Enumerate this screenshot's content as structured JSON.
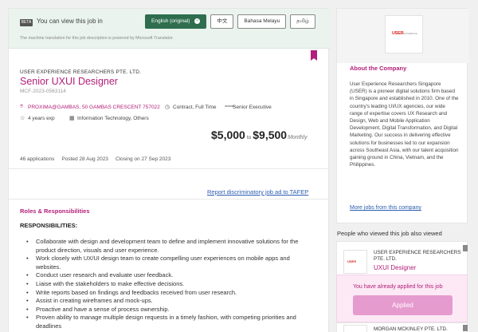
{
  "translation_bar": {
    "beta_badge": "BETA",
    "notice": "You can view this job in",
    "languages": [
      "English (original)",
      "中文",
      "Bahasa Melayu",
      "தமிழ்"
    ],
    "active_language": "English (original)",
    "check_glyph": "✓",
    "mt_disclaimer": "The machine translation for this job description is powered by Microsoft Translator."
  },
  "job": {
    "company": "USER EXPERIENCE RESEARCHERS PTE. LTD.",
    "title": "Senior UXUI Designer",
    "id": "MCF-2023-0563114",
    "address": "PROXIMA@GAMBAS, 50 GAMBAS CRESCENT 757022",
    "employment_type": "Contract, Full Time",
    "seniority": "Senior Executive",
    "experience": "4 years exp",
    "category": "Information Technology, Others",
    "salary_min": "$5,000",
    "salary_to": "to",
    "salary_max": "$9,500",
    "salary_period": "Monthly",
    "applications": "46 applications",
    "posted": "Posted 28 Aug 2023",
    "closing": "Closing on 27 Sep 2023",
    "report_link": "Report discriminatory job ad to TAFEP"
  },
  "description": {
    "section_heading": "Roles & Responsibilities",
    "sub_heading": "RESPONSIBILITIES:",
    "bullets": [
      "Collaborate with design and development team to define and implement innovative solutions for the product direction, visuals and user experience.",
      "Work closely with UX/UI design team to create compelling user experiences on mobile apps and websites.",
      "Conduct user research and evaluate user feedback.",
      "Liaise with the stakeholders to make effective decisions.",
      "Write reports based on findings and feedbacks received from user research.",
      "Assist in creating wireframes and mock-ups.",
      "Proactive and have a sense of process ownership.",
      "Proven ability to manage multiple design requests in a timely fashion, with competing priorities and deadlines"
    ]
  },
  "sidebar": {
    "logo_text": "USER",
    "logo_small": "EXPERIENCE",
    "about_heading": "About the Company",
    "about_text": "User Experience Researchers Singapore (USER) is a pioneer digital solutions firm based in Singapore and established in 2010. One of the country's leading UI/UX agencies, our wide range of expertise covers UX Research and Design, Web and Mobile Application Development, Digital Transformation, and Digital Marketing. Our success in delivering effective solutions for businesses led to our expansion across Southeast Asia, with our talent acquisition gaining ground in China, Vietnam, and the Philippines.",
    "more_jobs_link": "More jobs from this company",
    "also_viewed_heading": "People who viewed this job also viewed",
    "recommendations": [
      {
        "company": "USER EXPERIENCE RESEARCHERS PTE. LTD.",
        "title": "UXUI Designer",
        "logo_text": "USER"
      },
      {
        "company": "MORGAN MCKINLEY PTE. LTD."
      }
    ],
    "applied_message": "You have already applied for this job",
    "applied_button": "Applied"
  },
  "colors": {
    "brand": "#b21e78",
    "link": "#2a5db0",
    "active_language": "#2e6e4f",
    "applied_button": "#e69bcf"
  }
}
